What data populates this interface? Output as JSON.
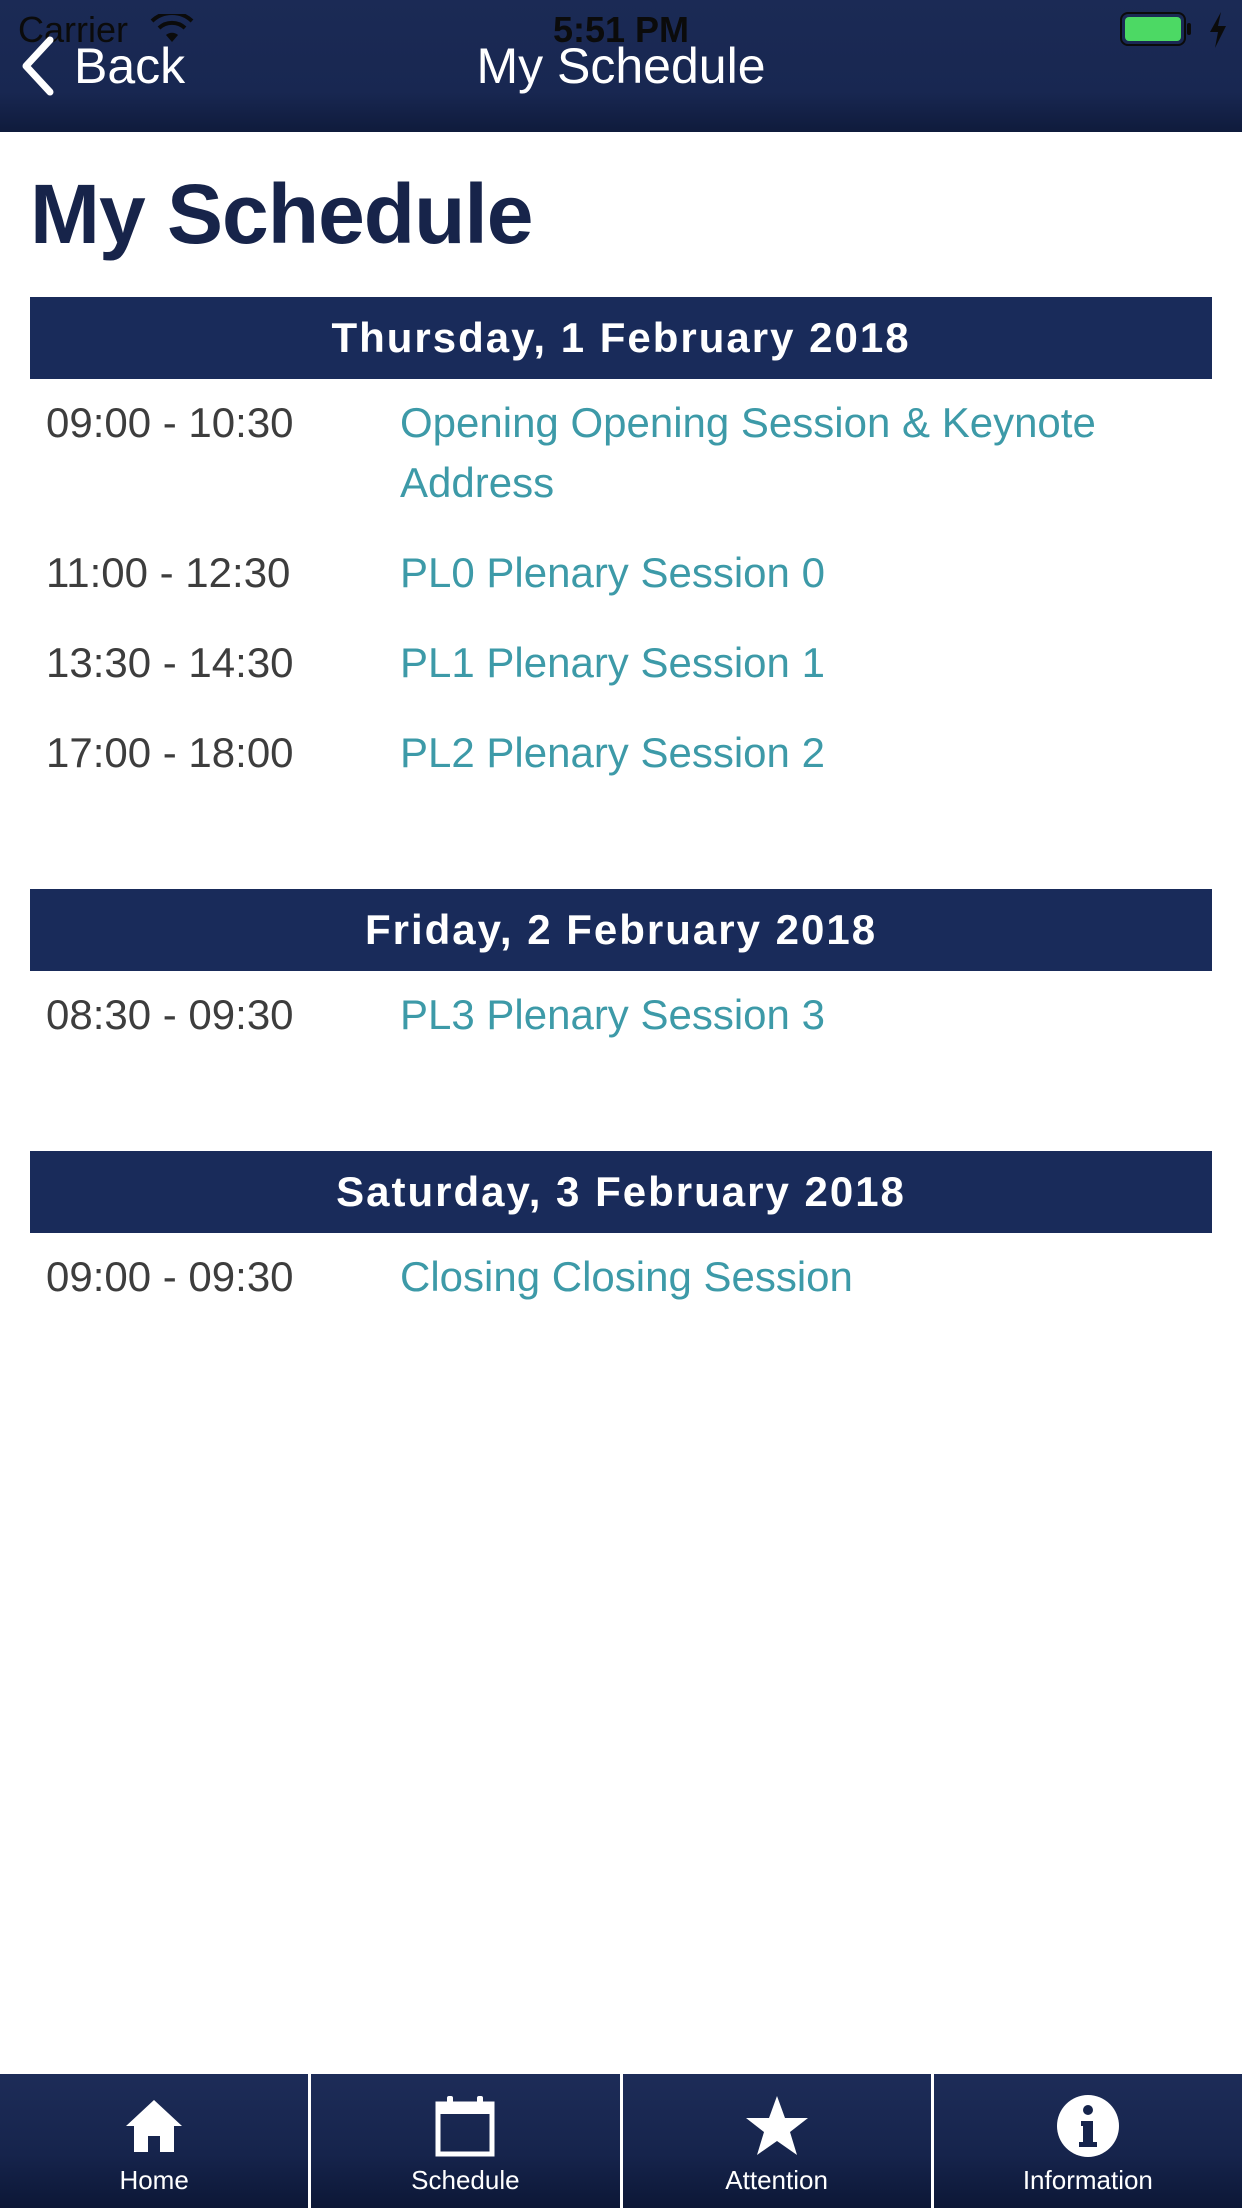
{
  "status_bar": {
    "carrier": "Carrier",
    "time": "5:51 PM",
    "battery_color": "#4cd964"
  },
  "nav": {
    "back_label": "Back",
    "title": "My Schedule"
  },
  "page_title": "My Schedule",
  "days": [
    {
      "date": "Thursday, 1 February 2018",
      "sessions": [
        {
          "time": "09:00 - 10:30",
          "title": "Opening Opening Session & Keynote Address"
        },
        {
          "time": "11:00 - 12:30",
          "title": "PL0 Plenary Session 0"
        },
        {
          "time": "13:30 - 14:30",
          "title": "PL1 Plenary Session 1"
        },
        {
          "time": "17:00 - 18:00",
          "title": "PL2 Plenary Session 2"
        }
      ]
    },
    {
      "date": "Friday, 2 February 2018",
      "sessions": [
        {
          "time": "08:30 - 09:30",
          "title": "PL3 Plenary Session 3"
        }
      ]
    },
    {
      "date": "Saturday, 3 February 2018",
      "sessions": [
        {
          "time": "09:00 - 09:30",
          "title": "Closing Closing Session"
        }
      ]
    }
  ],
  "tabs": [
    {
      "label": "Home",
      "icon": "home-icon"
    },
    {
      "label": "Schedule",
      "icon": "calendar-icon"
    },
    {
      "label": "Attention",
      "icon": "star-icon"
    },
    {
      "label": "Information",
      "icon": "info-icon"
    }
  ],
  "colors": {
    "nav_background": "#182751",
    "day_header_background": "#192b5a",
    "session_link": "#3d9aa8",
    "title_text": "#17244a"
  }
}
